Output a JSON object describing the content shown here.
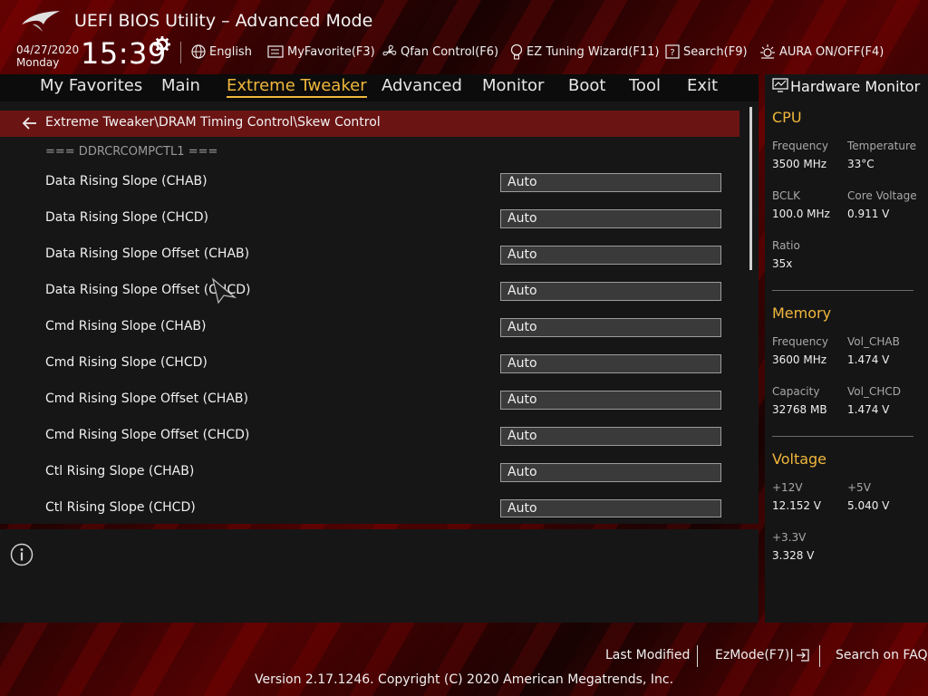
{
  "app": {
    "title": "UEFI BIOS Utility – Advanced Mode",
    "date": "04/27/2020",
    "day": "Monday",
    "time": "15:39"
  },
  "toolbar": {
    "language": "English",
    "myfavorite": "MyFavorite(F3)",
    "qfan": "Qfan Control(F6)",
    "ez_tuning": "EZ Tuning Wizard(F11)",
    "search": "Search(F9)",
    "aura": "AURA ON/OFF(F4)"
  },
  "tabs": [
    {
      "label": "My Favorites"
    },
    {
      "label": "Main"
    },
    {
      "label": "Extreme Tweaker",
      "active": true
    },
    {
      "label": "Advanced"
    },
    {
      "label": "Monitor"
    },
    {
      "label": "Boot"
    },
    {
      "label": "Tool"
    },
    {
      "label": "Exit"
    }
  ],
  "breadcrumb": "Extreme Tweaker\\DRAM Timing Control\\Skew Control",
  "section_header": "=== DDRCRCOMPCTL1 ===",
  "settings": [
    {
      "label": "Data Rising Slope (CHAB)",
      "value": "Auto"
    },
    {
      "label": "Data Rising Slope (CHCD)",
      "value": "Auto"
    },
    {
      "label": "Data Rising Slope Offset (CHAB)",
      "value": "Auto"
    },
    {
      "label": "Data Rising Slope Offset (CHCD)",
      "value": "Auto"
    },
    {
      "label": "Cmd Rising Slope (CHAB)",
      "value": "Auto"
    },
    {
      "label": "Cmd Rising Slope (CHCD)",
      "value": "Auto"
    },
    {
      "label": "Cmd Rising Slope Offset (CHAB)",
      "value": "Auto"
    },
    {
      "label": "Cmd Rising Slope Offset (CHCD)",
      "value": "Auto"
    },
    {
      "label": "Ctl Rising Slope (CHAB)",
      "value": "Auto"
    },
    {
      "label": "Ctl Rising Slope (CHCD)",
      "value": "Auto"
    }
  ],
  "hw": {
    "title": "Hardware Monitor",
    "cpu": {
      "heading": "CPU",
      "freq_label": "Frequency",
      "freq": "3500 MHz",
      "temp_label": "Temperature",
      "temp": "33°C",
      "bclk_label": "BCLK",
      "bclk": "100.0 MHz",
      "cvolt_label": "Core Voltage",
      "cvolt": "0.911 V",
      "ratio_label": "Ratio",
      "ratio": "35x"
    },
    "memory": {
      "heading": "Memory",
      "freq_label": "Frequency",
      "freq": "3600 MHz",
      "volab_label": "Vol_CHAB",
      "volab": "1.474 V",
      "cap_label": "Capacity",
      "cap": "32768 MB",
      "volcd_label": "Vol_CHCD",
      "volcd": "1.474 V"
    },
    "voltage": {
      "heading": "Voltage",
      "v12_label": "+12V",
      "v12": "12.152 V",
      "v5_label": "+5V",
      "v5": "5.040 V",
      "v33_label": "+3.3V",
      "v33": "3.328 V"
    }
  },
  "footer": {
    "last_modified": "Last Modified",
    "ezmode": "EzMode(F7)|",
    "search_faq": "Search on FAQ",
    "copyright": "Version 2.17.1246. Copyright (C) 2020 American Megatrends, Inc."
  },
  "colors": {
    "accent": "#f0b73c",
    "breadcrumb_bg": "#6b1414",
    "panel_bg": "#161616"
  },
  "icons": [
    "rog-logo",
    "gear-icon",
    "globe-icon",
    "favorite-icon",
    "fan-icon",
    "bulb-icon",
    "search-icon",
    "aura-icon",
    "back-arrow-icon",
    "info-icon",
    "monitor-icon",
    "exit-icon"
  ]
}
